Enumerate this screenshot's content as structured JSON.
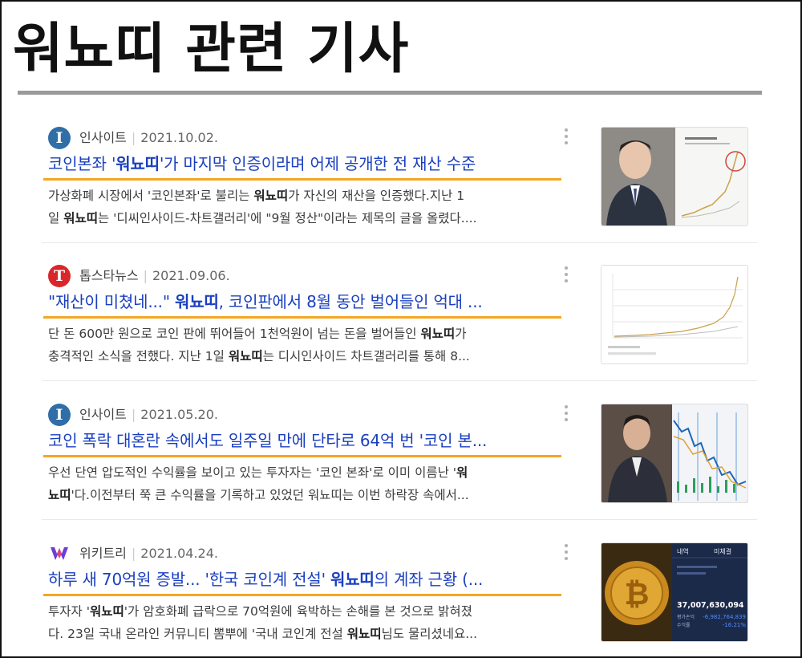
{
  "page": {
    "title": "워뇨띠 관련 기사"
  },
  "articles": [
    {
      "source": "인사이트",
      "source_logo": "I",
      "logo_color": "#2f6ea6",
      "date": "2021.10.02.",
      "headline": {
        "pre": "코인본좌 '",
        "strong": "워뇨띠",
        "post": "'가 마지막 인증이라며 어제 공개한 전 재산 수준"
      },
      "snippet_lines": [
        {
          "pre": "가상화폐 시장에서 '코인본좌'로 불리는 ",
          "strong": "워뇨띠",
          "post": "가 자신의 재산을 인증했다.지난 1"
        },
        {
          "pre": "일 ",
          "strong": "워뇨띠",
          "post": "는 '디씨인사이드-차트갤러리'에 \"9월 정산\"이라는 제목의 글을 올렸다...."
        }
      ],
      "thumbnail": "person-with-chart-thumbnail"
    },
    {
      "source": "톱스타뉴스",
      "source_logo": "T",
      "logo_color": "#d9262b",
      "date": "2021.09.06.",
      "headline": {
        "pre": "\"재산이 미쳤네...\" ",
        "strong": "워뇨띠",
        "post": ", 코인판에서 8월 동안 벌어들인 억대 ..."
      },
      "snippet_lines": [
        {
          "pre": "단 돈 600만 원으로 코인 판에 뛰어들어 1천억원이 넘는 돈을 벌어들인 ",
          "strong": "워뇨띠",
          "post": "가"
        },
        {
          "pre": "충격적인 소식을 전했다. 지난 1일 ",
          "strong": "워뇨띠",
          "post": "는 디시인사이드 차트갤러리를 통해 8..."
        }
      ],
      "thumbnail": "asset-chart-thumbnail"
    },
    {
      "source": "인사이트",
      "source_logo": "I",
      "logo_color": "#2f6ea6",
      "date": "2021.05.20.",
      "headline": {
        "pre": "코인 폭락 대혼란 속에서도 일주일 만에 단타로 64억 번 '코인 본...",
        "strong": "",
        "post": ""
      },
      "snippet_lines": [
        {
          "pre": "우선 단연 압도적인 수익률을 보이고 있는 투자자는 '코인 본좌'로 이미 이름난 '",
          "strong": "워",
          "post": ""
        },
        {
          "pre": "",
          "strong": "뇨띠",
          "post": "'다.이전부터 쭉 큰 수익률을 기록하고 있었던 워뇨띠는 이번 하락장 속에서..."
        }
      ],
      "thumbnail": "trader-with-stock-chart-thumbnail"
    },
    {
      "source": "위키트리",
      "source_logo": "W",
      "logo_color": "#6b3fd6",
      "date": "2021.04.24.",
      "headline": {
        "pre": "하루 새 70억원 증발... '한국 코인계 전설' ",
        "strong": "워뇨띠",
        "post": "의 계좌 근황 (..."
      },
      "snippet_lines": [
        {
          "pre": "투자자 '",
          "strong": "워뇨띠",
          "post": "'가 암호화폐 급락으로 70억원에 육박하는 손해를 본 것으로 밝혀졌"
        },
        {
          "pre": "다. 23일 국내 온라인 커뮤니티 뽐뿌에 '국내 코인계 전설 ",
          "strong": "워뇨띠",
          "post": "님도 물리셨네요..."
        }
      ],
      "thumbnail": "bitcoin-account-thumbnail"
    }
  ],
  "thumbnail_text": {
    "t4_tab1": "내역",
    "t4_tab2": "미체결",
    "t4_total": "37,007,630,094",
    "t4_loss": "-6,982,764,839",
    "t4_rate": "-16.21%",
    "t4_label1": "평가손익",
    "t4_label2": "수익률"
  },
  "colors": {
    "headline_link": "#1a3fbf",
    "underline_accent": "#f5a623",
    "title_rule": "#9a9a9a"
  }
}
